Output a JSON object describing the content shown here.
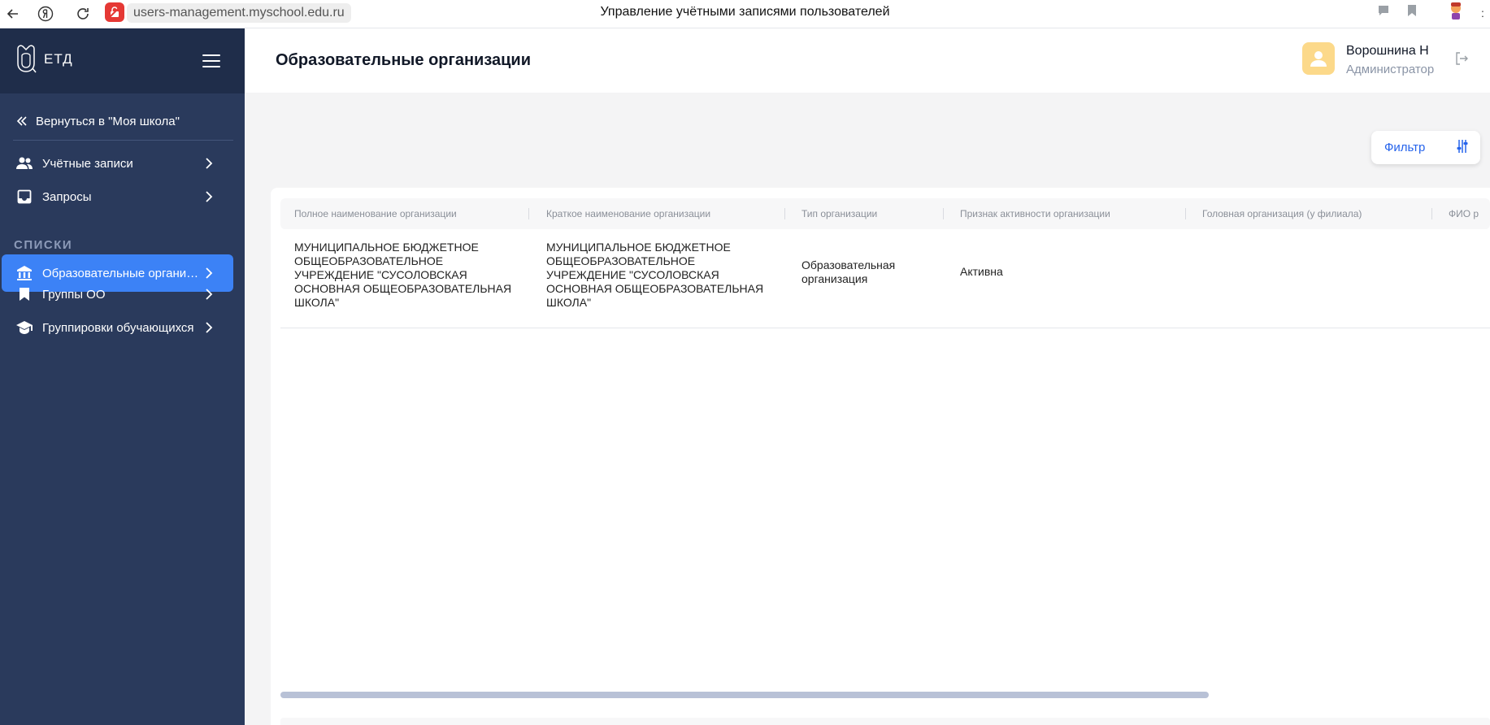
{
  "browser": {
    "url": "users-management.myschool.edu.ru",
    "tab_title": "Управление учётными записями пользователей"
  },
  "sidebar": {
    "logo_text": "ЕТД",
    "back_link": "Вернуться в \"Моя школа\"",
    "items": [
      {
        "label": "Учётные записи",
        "icon": "users-icon"
      },
      {
        "label": "Запросы",
        "icon": "inbox-icon"
      }
    ],
    "section_title": "СПИСКИ",
    "list_items": [
      {
        "label": "Образовательные организа...",
        "icon": "building-icon",
        "active": true
      },
      {
        "label": "Группы ОО",
        "icon": "bookmark-icon"
      },
      {
        "label": "Группировки обучающихся",
        "icon": "graduation-cap-icon"
      }
    ]
  },
  "header": {
    "title": "Образовательные организации",
    "user_name": "Ворошнина Н",
    "user_role": "Администратор"
  },
  "filter": {
    "label": "Фильтр"
  },
  "table": {
    "columns": [
      "Полное наименование организации",
      "Краткое наименование организации",
      "Тип организации",
      "Признак активности организации",
      "Головная организация (у филиала)",
      "ФИО р"
    ],
    "rows": [
      {
        "full_name": "МУНИЦИПАЛЬНОЕ БЮДЖЕТНОЕ ОБЩЕОБРАЗОВАТЕЛЬНОЕ УЧРЕЖДЕНИЕ \"СУСОЛОВСКАЯ ОСНОВНАЯ ОБЩЕОБРАЗОВАТЕЛЬНАЯ ШКОЛА\"",
        "short_name": "МУНИЦИПАЛЬНОЕ БЮДЖЕТНОЕ ОБЩЕОБРАЗОВАТЕЛЬНОЕ УЧРЕЖДЕНИЕ \"СУСОЛОВСКАЯ ОСНОВНАЯ ОБЩЕОБРАЗОВАТЕЛЬНАЯ ШКОЛА\"",
        "type": "Образовательная организация",
        "activity": "Активна"
      }
    ]
  },
  "colors": {
    "sidebar_bg": "#2a3a5c",
    "sidebar_head_bg": "#1f2d4a",
    "accent": "#3c82f6",
    "avatar_bg": "#fcd98a"
  }
}
